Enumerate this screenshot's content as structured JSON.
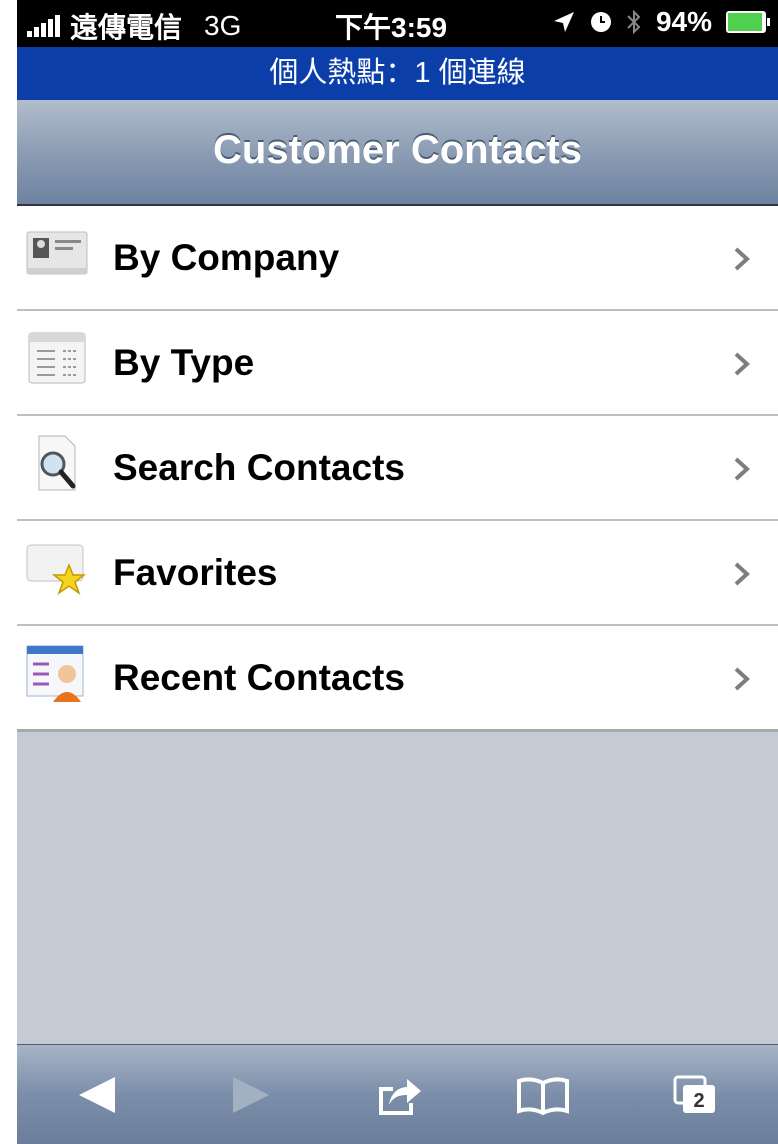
{
  "status_bar": {
    "carrier": "遠傳電信",
    "network": "3G",
    "time": "下午3:59",
    "battery": "94%"
  },
  "hotspot": {
    "text": "個人熱點：1 個連線"
  },
  "nav": {
    "title": "Customer Contacts"
  },
  "menu": [
    {
      "label": "By Company",
      "icon": "company-card-icon"
    },
    {
      "label": "By Type",
      "icon": "calendar-grid-icon"
    },
    {
      "label": "Search Contacts",
      "icon": "search-document-icon"
    },
    {
      "label": "Favorites",
      "icon": "star-icon"
    },
    {
      "label": "Recent Contacts",
      "icon": "recent-contact-icon"
    }
  ],
  "toolbar": {
    "tabs_count": "2",
    "icons": [
      "back-arrow-icon",
      "forward-arrow-icon",
      "share-icon",
      "bookmarks-icon",
      "tabs-icon"
    ]
  },
  "colors": {
    "hotspot_bar": "#0b3ea9",
    "nav_bar": "#8c9db4",
    "background": "#c5cbd4"
  }
}
